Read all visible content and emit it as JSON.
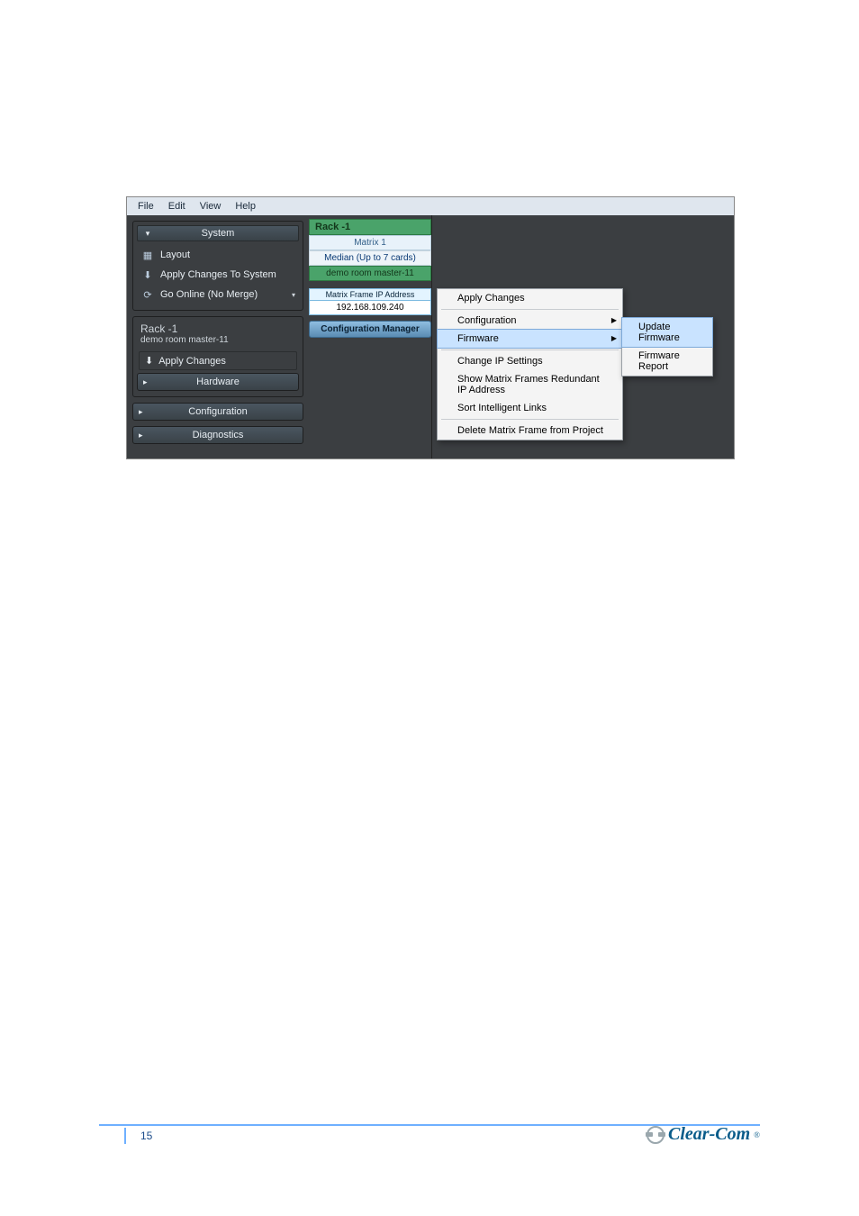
{
  "menu": {
    "file": "File",
    "edit": "Edit",
    "view": "View",
    "help": "Help"
  },
  "system_panel": {
    "title": "System",
    "items": {
      "layout": "Layout",
      "apply": "Apply Changes To System",
      "online": "Go Online (No Merge)"
    }
  },
  "rack_panel": {
    "title": "Rack -1",
    "subtitle": "demo room master-11",
    "apply": "Apply Changes"
  },
  "collapsed": {
    "hardware": "Hardware",
    "configuration": "Configuration",
    "diagnostics": "Diagnostics"
  },
  "center": {
    "rack": "Rack -1",
    "matrix": "Matrix 1",
    "cards": "Median (Up to 7 cards)",
    "name": "demo room master-11",
    "ip_label": "Matrix Frame IP Address",
    "ip_value": "192.168.109.240",
    "cfg_mgr": "Configuration Manager"
  },
  "ctx": {
    "apply": "Apply Changes",
    "config": "Configuration",
    "firmware": "Firmware",
    "change_ip": "Change IP Settings",
    "show_redun": "Show Matrix Frames Redundant IP Address",
    "sort": "Sort Intelligent Links",
    "delete": "Delete Matrix Frame from Project"
  },
  "submenu": {
    "update": "Update Firmware",
    "report": "Firmware Report"
  },
  "footer": {
    "page": "15",
    "brand": "Clear-Com"
  }
}
